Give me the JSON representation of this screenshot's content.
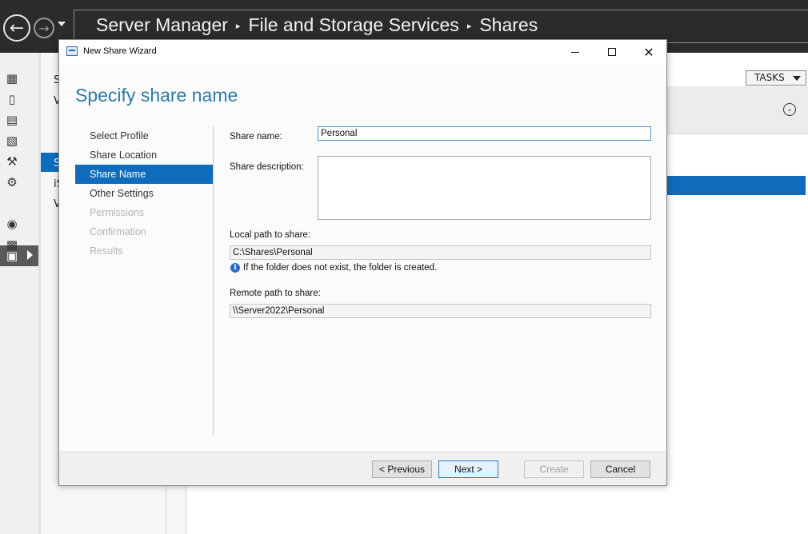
{
  "server_manager": {
    "breadcrumb": [
      "Server Manager",
      "File and Storage Services",
      "Shares"
    ],
    "breadcrumb_separator": "▸",
    "subpanel_fragments": [
      "S",
      "V",
      "S",
      "iS",
      "V"
    ],
    "tasks_label": "TASKS"
  },
  "wizard": {
    "window_title": "New Share Wizard",
    "heading": "Specify share name",
    "steps": [
      {
        "label": "Select Profile",
        "state": "normal"
      },
      {
        "label": "Share Location",
        "state": "normal"
      },
      {
        "label": "Share Name",
        "state": "active"
      },
      {
        "label": "Other Settings",
        "state": "normal"
      },
      {
        "label": "Permissions",
        "state": "disabled"
      },
      {
        "label": "Confirmation",
        "state": "disabled"
      },
      {
        "label": "Results",
        "state": "disabled"
      }
    ],
    "form": {
      "share_name_label": "Share name:",
      "share_name_value": "Personal",
      "share_description_label": "Share description:",
      "share_description_value": "",
      "local_path_label": "Local path to share:",
      "local_path_value": "C:\\Shares\\Personal",
      "info_note": "If the folder does not exist, the folder is created.",
      "remote_path_label": "Remote path to share:",
      "remote_path_value": "\\\\Server2022\\Personal"
    },
    "buttons": {
      "previous": "< Previous",
      "next": "Next >",
      "create": "Create",
      "cancel": "Cancel"
    }
  },
  "colors": {
    "accent": "#0f6cbd",
    "heading": "#2d7aa8",
    "topbar": "#2b2b2b"
  }
}
